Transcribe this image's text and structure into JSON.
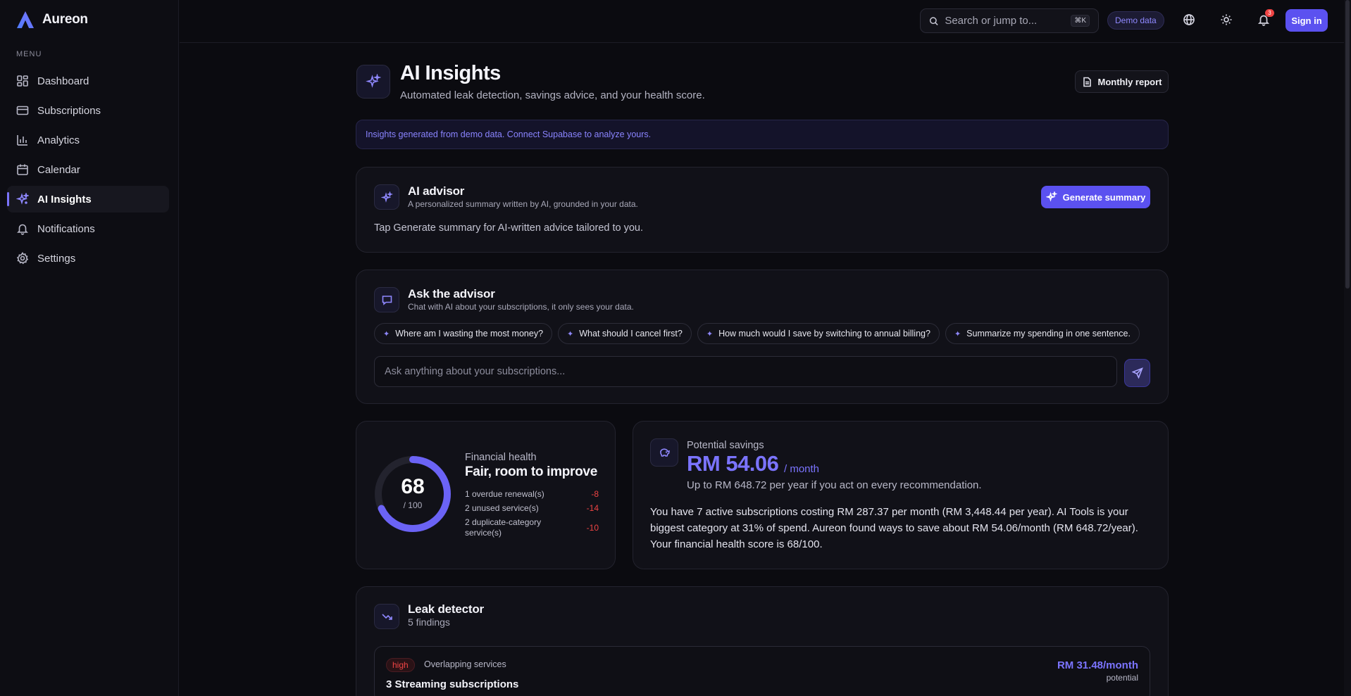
{
  "app": {
    "name": "Aureon",
    "menu_label": "MENU"
  },
  "sidebar": {
    "items": [
      {
        "label": "Dashboard",
        "icon": "grid-icon",
        "active": false
      },
      {
        "label": "Subscriptions",
        "icon": "card-icon",
        "active": false
      },
      {
        "label": "Analytics",
        "icon": "bar-chart-icon",
        "active": false
      },
      {
        "label": "Calendar",
        "icon": "calendar-icon",
        "active": false
      },
      {
        "label": "AI Insights",
        "icon": "sparkles-icon",
        "active": true
      },
      {
        "label": "Notifications",
        "icon": "bell-icon",
        "active": false
      },
      {
        "label": "Settings",
        "icon": "gear-icon",
        "active": false
      }
    ]
  },
  "topbar": {
    "search_placeholder": "Search or jump to...",
    "search_shortcut": "⌘K",
    "demo_badge": "Demo data",
    "notification_count": "3",
    "signin_label": "Sign in"
  },
  "page": {
    "title": "AI Insights",
    "subtitle": "Automated leak detection, savings advice, and your health score.",
    "report_button": "Monthly report",
    "banner": "Insights generated from demo data. Connect Supabase to analyze yours."
  },
  "advisor": {
    "title": "AI advisor",
    "subtitle": "A personalized summary written by AI, grounded in your data.",
    "generate_button": "Generate summary",
    "hint": "Tap Generate summary for AI-written advice tailored to you."
  },
  "ask": {
    "title": "Ask the advisor",
    "subtitle": "Chat with AI about your subscriptions, it only sees your data.",
    "suggestions": [
      "Where am I wasting the most money?",
      "What should I cancel first?",
      "How much would I save by switching to annual billing?",
      "Summarize my spending in one sentence."
    ],
    "input_placeholder": "Ask anything about your subscriptions..."
  },
  "health": {
    "score": "68",
    "score_value": 68,
    "max": "/ 100",
    "label": "Financial health",
    "status": "Fair, room to improve",
    "factors": [
      {
        "text": "1 overdue renewal(s)",
        "value": "-8"
      },
      {
        "text": "2 unused service(s)",
        "value": "-14"
      },
      {
        "text": "2 duplicate-category service(s)",
        "value": "-10"
      }
    ],
    "colors": {
      "track": "#23232e",
      "fill": "#6b63f5"
    }
  },
  "savings": {
    "label": "Potential savings",
    "amount": "RM 54.06",
    "unit": "/ month",
    "yearly": "Up to RM 648.72 per year if you act on every recommendation.",
    "summary": "You have 7 active subscriptions costing RM 287.37 per month (RM 3,448.44 per year). AI Tools is your biggest category at 31% of spend. Aureon found ways to save about RM 54.06/month (RM 648.72/year). Your financial health score is 68/100."
  },
  "leak": {
    "title": "Leak detector",
    "count": "5 findings",
    "findings": [
      {
        "severity": "high",
        "category": "Overlapping services",
        "title": "3 Streaming subscriptions",
        "amount": "RM 31.48/month",
        "note": "potential"
      }
    ]
  },
  "colors": {
    "accent": "#5b51f0",
    "accent_text": "#7b74ff",
    "danger": "#ef4444",
    "background": "#0b0b10"
  }
}
